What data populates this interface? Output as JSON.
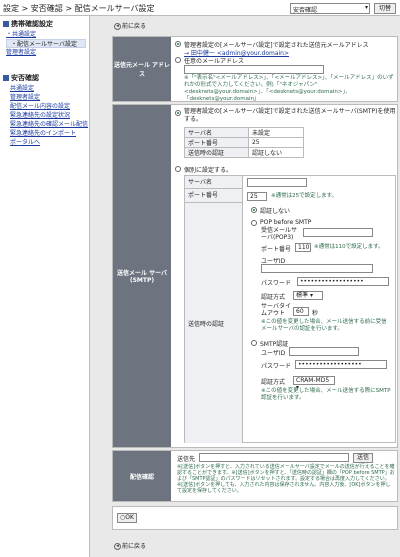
{
  "header": {
    "breadcrumb": "設定 > 安否確認 > 配信メールサーバ設定",
    "select_value": "安否確認",
    "switch_label": "切替"
  },
  "sidebar": {
    "section1_title": "携帯確認設定",
    "section1_items": [
      {
        "label": "・共通設定"
      },
      {
        "label": "・配信メールサーバ設定"
      },
      {
        "label": "管理者設定"
      }
    ],
    "section2_title": "安否確認",
    "section2_items": [
      {
        "label": "共通設定"
      },
      {
        "label": "管理者設定"
      },
      {
        "label": "配信メール内容の設定"
      },
      {
        "label": "緊急連絡先の設定状況"
      },
      {
        "label": "緊急連絡先の確認メール配信"
      },
      {
        "label": "緊急連絡先のインポート"
      },
      {
        "label": "ポータルへ"
      }
    ]
  },
  "main": {
    "back_label": "前に戻る",
    "sender": {
      "label": "送信元メール アドレス",
      "opt1": "管理者設定の[メールサーバ設定]で設定された送信元メールアドレス",
      "opt1_link": "→ 田中健一 <admin@your.domain>",
      "opt2": "任意のメールアドレス",
      "note": "※「\"表示名\"<メールアドレス>」、「<メールアドレス>」、「メールアドレス」のいずれかの形式で入力してください。例)「\"ネオジャパン\"<desknets@your.domain>」、「<desknets@your.domain>」、「desknets@your.domain」"
    },
    "server": {
      "label": "送信メール サーバ(SMTP)",
      "opt1": "管理者設定の[メールサーバ設定]で設定された送信メールサーバ(SMTP)を使用する。",
      "table": [
        {
          "k": "サーバ名",
          "v": "未設定"
        },
        {
          "k": "ポート番号",
          "v": "25"
        },
        {
          "k": "送信時の認証",
          "v": "認証しない"
        }
      ],
      "opt2": "個別に設定する。",
      "server_name_label": "サーバ名",
      "port_label": "ポート番号",
      "port_value": "25",
      "port_note": "※通常は25で設定します。",
      "auth_label": "送信時の認証",
      "auth_none": "認証しない",
      "pop_label": "POP before SMTP",
      "pop_server_label": "受信メールサーバ(POP3)",
      "pop_port_label": "ポート番号",
      "pop_port_value": "110",
      "pop_port_note": "※通常は110で設定します。",
      "user_label": "ユーザID",
      "pass_label": "パスワード",
      "pass_value": "••••••••••••••••••",
      "method_label": "認証方式",
      "method_value": "標準",
      "timeout_label": "サーバタイムアウト",
      "timeout_value": "60",
      "timeout_unit": "秒",
      "pop_note": "※この値を変更した場合、メール送信する前に受信メールサーバの認証を行います。",
      "smtp_label": "SMTP認証",
      "smtp_user_label": "ユーザID",
      "smtp_pass_label": "パスワード",
      "smtp_pass_value": "••••••••••••••••••",
      "smtp_method_label": "認証方式",
      "smtp_method_value": "CRAM-MD5",
      "smtp_note": "※この値を変更した場合、メール送信する際にSMTP認証を行います。"
    },
    "test": {
      "label": "配信確認",
      "to_label": "送信先",
      "send_label": "送信",
      "note": "※[送信]ボタンを押すと、入力されている送信メールサーバ設定でメールの送信が行えることを確認することができます。※[送信]ボタンを押すと、「送信時の認証」欄の「POP before SMTP」および「SMTP認証」のパスワードはリセットされます。設定する場合は再度入力してください。※[送信]ボタンを押しても、入力された内容は保存されません。内容入力後、[OK]ボタンを押して設定を保存してください。"
    },
    "ok_label": "OK",
    "back_bottom_label": "前に戻る"
  }
}
